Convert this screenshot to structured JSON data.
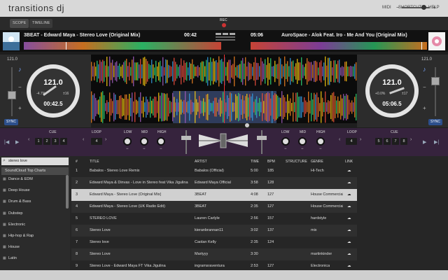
{
  "app": {
    "title": "transitions dj"
  },
  "menu": [
    "MIDI",
    "SHORTCUTS",
    "HELP"
  ],
  "modes": [
    "SCOPE",
    "TIMELINE"
  ],
  "rec_label": "REC",
  "deck_left": {
    "title": "3BEAT - Edward Maya - Stereo Love (Original Mix)",
    "time": "00:42",
    "bpm": "121.0",
    "jog_bpm": "121.0",
    "jog_time": "00:42.5",
    "pitch": "-4.7%",
    "beat": "±16",
    "sync": "SYNC"
  },
  "deck_right": {
    "title": "AuroSpace - Alok Feat. Iro - Me And You (Original Mix)",
    "time": "05:06",
    "bpm": "121.0",
    "jog_bpm": "121.0",
    "jog_time": "05:06.5",
    "pitch": "+0.0%",
    "beat": "±17",
    "sync": "SYNC"
  },
  "controls": {
    "cue": "CUE",
    "loop": "LOOP",
    "low": "LOW",
    "mid": "MID",
    "high": "HIGH",
    "left_cues": [
      "1",
      "2",
      "3",
      "4"
    ],
    "right_cues": [
      "5",
      "6",
      "7",
      "8"
    ],
    "loop_left": "4",
    "loop_right": "4"
  },
  "search": {
    "value": "stereo love"
  },
  "sidebar": {
    "header": "SoundCloud Top Charts",
    "genres": [
      "Dance & EDM",
      "Deep House",
      "Drum & Bass",
      "Dubstep",
      "Electronic",
      "Hip-hop & Rap",
      "House",
      "Latin"
    ]
  },
  "table": {
    "headers": [
      "#",
      "TITLE",
      "ARTIST",
      "TIME",
      "BPM",
      "STRUCTURE",
      "GENRE",
      "LINK"
    ],
    "rows": [
      [
        "1",
        "Babalos - Stereo Love Remix",
        "Babalos (Official)",
        "5:00",
        "185",
        "",
        "Hi-Tech"
      ],
      [
        "2",
        "Edward Maya & Dinvas - Love in Stereo feat Vika Jigulina",
        "Edward Maya Official",
        "3:58",
        "128",
        "",
        ""
      ],
      [
        "3",
        "Edward Maya - Stereo Love (Original Mix)",
        "3BEAT",
        "4:08",
        "127",
        "",
        "House Commercial"
      ],
      [
        "4",
        "Edward Maya - Stereo Love (UK Radio Edit)",
        "3BEAT",
        "2:35",
        "127",
        "",
        "House Commercial"
      ],
      [
        "5",
        "STEREO LOVE",
        "Lauren Carlyle",
        "2:56",
        "157",
        "",
        "hardstyle"
      ],
      [
        "6",
        "Stereo Love",
        "kieranbrannan11",
        "3:02",
        "137",
        "",
        "mix"
      ],
      [
        "7",
        "Stereo love",
        "Caolan Kelly",
        "2:35",
        "124",
        "",
        ""
      ],
      [
        "8",
        "Stereo Love",
        "Martyyy",
        "3:30",
        "",
        "",
        "martinkinder"
      ],
      [
        "9",
        "Stereo Love - Edward Maya FT Vika Jigulina",
        "ingramsraventura",
        "2:53",
        "127",
        "",
        "Electronica"
      ]
    ],
    "link_icon": "cloud-icon"
  }
}
